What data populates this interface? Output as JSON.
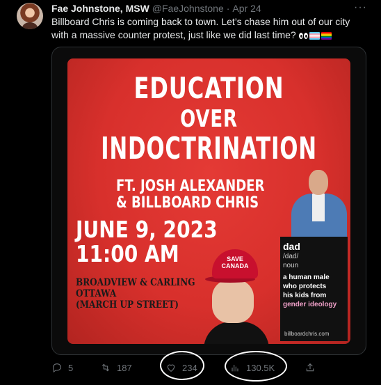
{
  "tweet": {
    "display_name": "Fae Johnstone, MSW",
    "handle": "@FaeJohnstone",
    "separator": "·",
    "date": "Apr 24",
    "more_glyph": "···",
    "text": "Billboard Chris is coming back to town. Let’s chase him out of our city with a massive counter protest, just like we did last time?",
    "emojis": [
      "eyes-emoji",
      "transgender-flag-emoji",
      "rainbow-flag-emoji"
    ]
  },
  "poster": {
    "title_line1": "EDUCATION",
    "title_line2": "OVER",
    "title_line3": "INDOCTRINATION",
    "featuring_line1": "FT. JOSH ALEXANDER",
    "featuring_line2": "& BILLBOARD CHRIS",
    "date_line": "JUNE 9, 2023",
    "time_line": "11:00 AM",
    "location_line1": "BROADVIEW & CARLING",
    "location_line2": "OTTAWA",
    "location_line3": "(MARCH UP STREET)",
    "hat_text_line1": "SAVE",
    "hat_text_line2": "CANADA",
    "sign": {
      "word": "dad",
      "phonetic": "/dad/",
      "part_of_speech": "noun",
      "definition_line1": "a human male",
      "definition_line2": "who protects",
      "definition_line3": "his kids from",
      "definition_highlight": "gender ideology",
      "url": "billboardchris.com"
    },
    "colors": {
      "background": "#d8302c",
      "hat": "#c8102e",
      "highlight": "#f0a0c8"
    }
  },
  "actions": {
    "replies": "5",
    "retweets": "187",
    "likes": "234",
    "views": "130.5K"
  }
}
